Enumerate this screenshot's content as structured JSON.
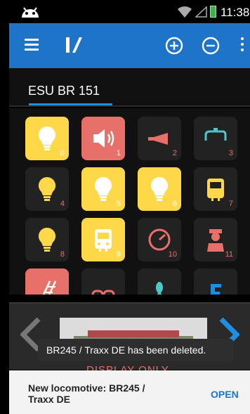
{
  "status_bar": {
    "time": "11:38"
  },
  "loco_tab": {
    "label": "ESU BR 151"
  },
  "functions": [
    {
      "num": "0",
      "icon": "light-bulb-icon",
      "style": "yellow"
    },
    {
      "num": "1",
      "icon": "horn-speaker-icon",
      "style": "red"
    },
    {
      "num": "2",
      "icon": "horn-icon",
      "style": "dark"
    },
    {
      "num": "3",
      "icon": "water-tap-icon",
      "style": "dark"
    },
    {
      "num": "4",
      "icon": "light-bulb-icon",
      "style": "dark"
    },
    {
      "num": "5",
      "icon": "light-bulb-icon",
      "style": "yellow"
    },
    {
      "num": "6",
      "icon": "light-bulb-icon",
      "style": "yellow"
    },
    {
      "num": "7",
      "icon": "locomotive-front-icon",
      "style": "dark"
    },
    {
      "num": "8",
      "icon": "light-bulb-icon",
      "style": "dark"
    },
    {
      "num": "9",
      "icon": "locomotive-front-icon",
      "style": "yellow"
    },
    {
      "num": "10",
      "icon": "speedometer-icon",
      "style": "dark"
    },
    {
      "num": "11",
      "icon": "conductor-icon",
      "style": "dark"
    },
    {
      "num": "",
      "icon": "track-icon",
      "style": "red"
    },
    {
      "num": "",
      "icon": "coupler-icon",
      "style": "dark"
    },
    {
      "num": "",
      "icon": "fan-icon",
      "style": "dark"
    },
    {
      "num": "",
      "icon": "letter-f-icon",
      "style": "dark"
    }
  ],
  "controls": {
    "display_only": "DISPLAY ONLY"
  },
  "toast": {
    "message": "BR245 / Traxx DE has been deleted."
  },
  "snackbar": {
    "message": "New locomotive: BR245 / Traxx DE",
    "action": "OPEN"
  },
  "colors": {
    "app_bar": "#1e74c8",
    "tile_yellow": "#ffd84a",
    "tile_red": "#e8706a",
    "tile_dark": "#222222",
    "accent": "#1e8fe0"
  }
}
